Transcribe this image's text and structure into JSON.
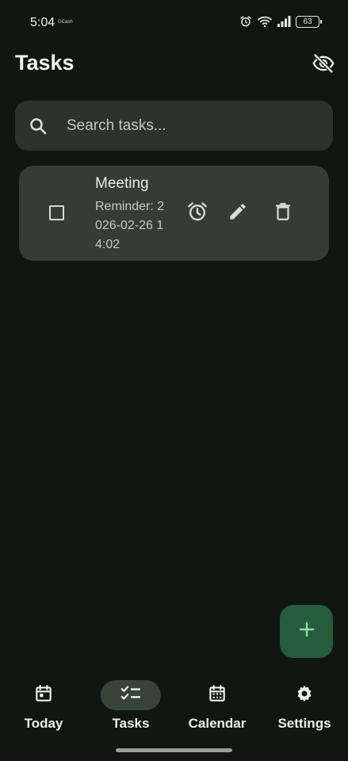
{
  "status_bar": {
    "time": "5:04",
    "carrier": "GCash",
    "battery": "63",
    "icons": [
      "alarm-icon",
      "wifi-icon",
      "signal-icon",
      "battery-icon"
    ]
  },
  "header": {
    "title": "Tasks",
    "visibility_icon": "visibility-off-icon"
  },
  "search": {
    "placeholder": "Search tasks..."
  },
  "tasks": [
    {
      "title": "Meeting",
      "reminder": "Reminder: 2026-02-26 14:02",
      "completed": false
    }
  ],
  "fab": {
    "icon": "add-icon"
  },
  "bottom_nav": {
    "items": [
      {
        "label": "Today",
        "icon": "calendar-today-icon",
        "active": false
      },
      {
        "label": "Tasks",
        "icon": "checklist-icon",
        "active": true
      },
      {
        "label": "Calendar",
        "icon": "calendar-month-icon",
        "active": false
      },
      {
        "label": "Settings",
        "icon": "gear-icon",
        "active": false
      }
    ]
  },
  "colors": {
    "background": "#111612",
    "surface": "#2c322d",
    "card": "#363b36",
    "fab": "#245c3d",
    "fab_icon": "#8ee0a8",
    "nav_active_pill": "#374437"
  }
}
